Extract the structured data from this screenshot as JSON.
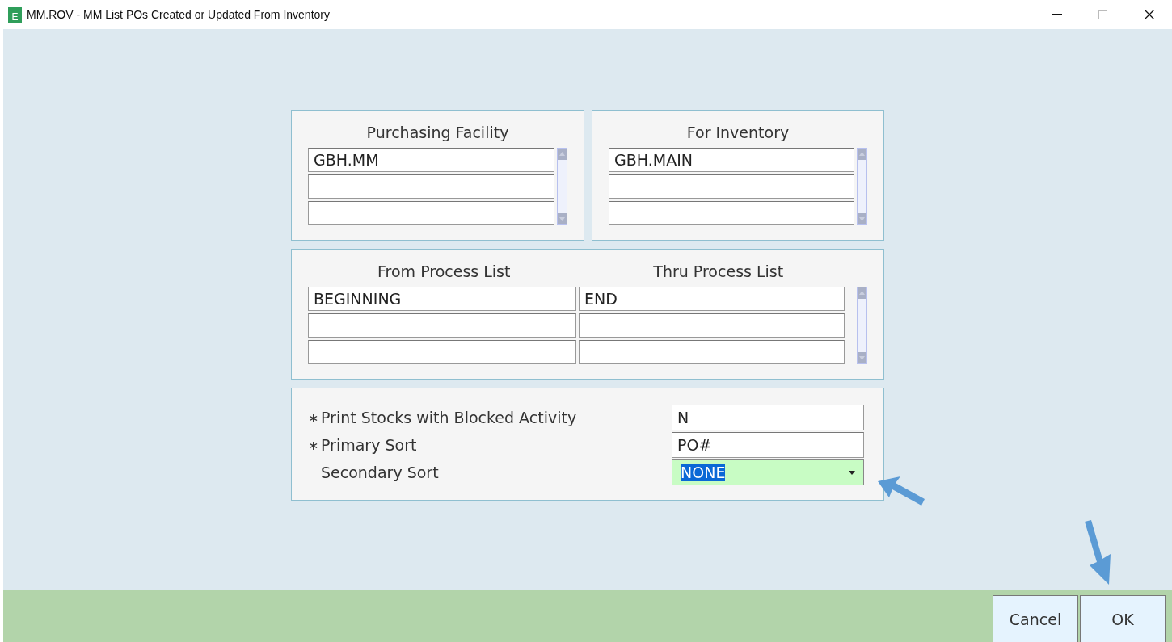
{
  "window": {
    "title": "MM.ROV - MM List POs Created or Updated From Inventory",
    "app_icon_text": "E"
  },
  "facility_panels": [
    {
      "title": "Purchasing Facility",
      "values": [
        "GBH.MM"
      ]
    },
    {
      "title": "For Inventory",
      "values": [
        "GBH.MAIN"
      ]
    }
  ],
  "process_panel": {
    "columns": [
      "From Process List",
      "Thru Process List"
    ],
    "rows": [
      [
        "BEGINNING",
        "END"
      ]
    ]
  },
  "options": [
    {
      "marker": "∗",
      "label": "Print Stocks with Blocked Activity",
      "kind": "text",
      "value": "N"
    },
    {
      "marker": "∗",
      "label": "Primary Sort",
      "kind": "text",
      "value": "PO#"
    },
    {
      "label": "Secondary Sort",
      "kind": "dropdown",
      "value": "NONE",
      "highlighted": true
    }
  ],
  "buttons": [
    "Cancel",
    "OK"
  ]
}
